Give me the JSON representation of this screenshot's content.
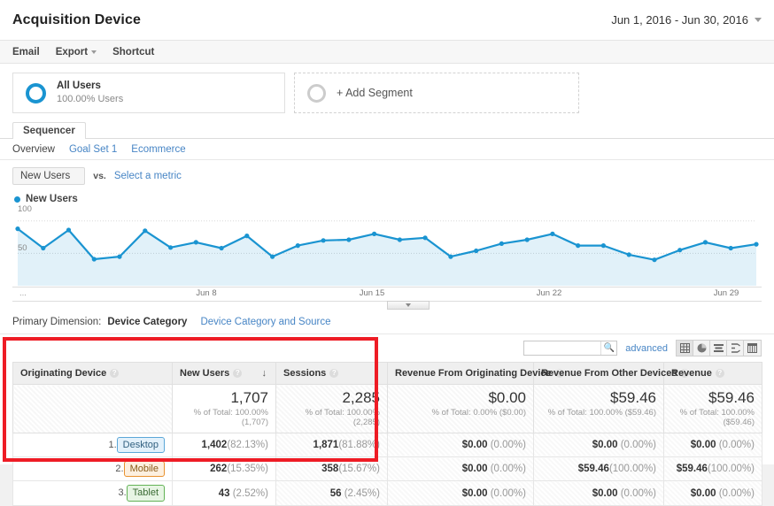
{
  "header": {
    "title": "Acquisition Device",
    "date_range": "Jun 1, 2016 - Jun 30, 2016"
  },
  "actionbar": {
    "items": [
      {
        "label": "Email",
        "has_caret": false
      },
      {
        "label": "Export",
        "has_caret": true
      },
      {
        "label": "Shortcut",
        "has_caret": false
      }
    ]
  },
  "segments": {
    "all_users": {
      "name": "All Users",
      "sub": "100.00% Users"
    },
    "add_segment": {
      "label": "+ Add Segment"
    }
  },
  "tabs": {
    "primary": "Sequencer",
    "subnav": [
      {
        "label": "Overview",
        "active": true
      },
      {
        "label": "Goal Set 1",
        "active": false
      },
      {
        "label": "Ecommerce",
        "active": false
      }
    ]
  },
  "metric_selector": {
    "selected": "New Users",
    "vs_label": "vs.",
    "compare_link": "Select a metric"
  },
  "chart_data": {
    "type": "area",
    "title": "",
    "series_name": "New Users",
    "legend_label": "New Users",
    "legend_position": "top-left",
    "color": "#1a94d1",
    "xlabel": "",
    "ylabel": "",
    "ylim": [
      0,
      112
    ],
    "ytick_labels": [
      "100",
      "50"
    ],
    "ytick_values": [
      100,
      50
    ],
    "grid": true,
    "x_tick_labels": [
      "...",
      "Jun 8",
      "Jun 15",
      "Jun 22",
      "Jun 29"
    ],
    "x": [
      "Jun 1",
      "Jun 2",
      "Jun 3",
      "Jun 4",
      "Jun 5",
      "Jun 6",
      "Jun 7",
      "Jun 8",
      "Jun 9",
      "Jun 10",
      "Jun 11",
      "Jun 12",
      "Jun 13",
      "Jun 14",
      "Jun 15",
      "Jun 16",
      "Jun 17",
      "Jun 18",
      "Jun 19",
      "Jun 20",
      "Jun 21",
      "Jun 22",
      "Jun 23",
      "Jun 24",
      "Jun 25",
      "Jun 26",
      "Jun 27",
      "Jun 28",
      "Jun 29",
      "Jun 30"
    ],
    "values": [
      88,
      58,
      86,
      41,
      45,
      85,
      59,
      67,
      58,
      77,
      45,
      62,
      70,
      71,
      80,
      71,
      74,
      45,
      54,
      65,
      71,
      80,
      62,
      62,
      48,
      40,
      55,
      67,
      58,
      64
    ]
  },
  "primary_dimension": {
    "label": "Primary Dimension:",
    "selected": "Device Category",
    "link": "Device Category and Source"
  },
  "table_controls": {
    "search_placeholder": "",
    "search_value": "",
    "advanced_label": "advanced",
    "view_icons": [
      "table-view-icon",
      "pie-view-icon",
      "performance-view-icon",
      "comparison-view-icon",
      "pivot-view-icon"
    ],
    "selected_view": "table-view-icon"
  },
  "table": {
    "columns": [
      {
        "label": "Originating Device",
        "sorted": false
      },
      {
        "label": "New Users",
        "sorted": true,
        "sort_arrow": "↓"
      },
      {
        "label": "Sessions",
        "sorted": false
      },
      {
        "label": "Revenue From Originating Device",
        "sorted": false
      },
      {
        "label": "Revenue From Other Devices",
        "sorted": false
      },
      {
        "label": "Revenue",
        "sorted": false
      }
    ],
    "summary": [
      {
        "value": "",
        "sub": ""
      },
      {
        "value": "1,707",
        "sub": "% of Total: 100.00% (1,707)"
      },
      {
        "value": "2,285",
        "sub": "% of Total: 100.00% (2,285)"
      },
      {
        "value": "$0.00",
        "sub": "% of Total: 0.00% ($0.00)"
      },
      {
        "value": "$59.46",
        "sub": "% of Total: 100.00% ($59.46)"
      },
      {
        "value": "$59.46",
        "sub": "% of Total: 100.00% ($59.46)"
      }
    ],
    "rows": [
      {
        "index": "1.",
        "device": "Desktop",
        "device_type": "desktop",
        "new_users": "1,402",
        "new_users_pct": "(82.13%)",
        "sessions": "1,871",
        "sessions_pct": "(81.88%)",
        "rev_originating": "$0.00",
        "rev_originating_pct": "(0.00%)",
        "rev_other": "$0.00",
        "rev_other_pct": "(0.00%)",
        "revenue": "$0.00",
        "revenue_pct": "(0.00%)"
      },
      {
        "index": "2.",
        "device": "Mobile",
        "device_type": "mobile",
        "new_users": "262",
        "new_users_pct": "(15.35%)",
        "sessions": "358",
        "sessions_pct": "(15.67%)",
        "rev_originating": "$0.00",
        "rev_originating_pct": "(0.00%)",
        "rev_other": "$59.46",
        "rev_other_pct": "(100.00%)",
        "revenue": "$59.46",
        "revenue_pct": "(100.00%)"
      },
      {
        "index": "3.",
        "device": "Tablet",
        "device_type": "tablet",
        "new_users": "43",
        "new_users_pct": "(2.52%)",
        "sessions": "56",
        "sessions_pct": "(2.45%)",
        "rev_originating": "$0.00",
        "rev_originating_pct": "(0.00%)",
        "rev_other": "$0.00",
        "rev_other_pct": "(0.00%)",
        "revenue": "$0.00",
        "revenue_pct": "(0.00%)"
      }
    ]
  },
  "annotation": {
    "highlight_color": "#ee1c25"
  }
}
